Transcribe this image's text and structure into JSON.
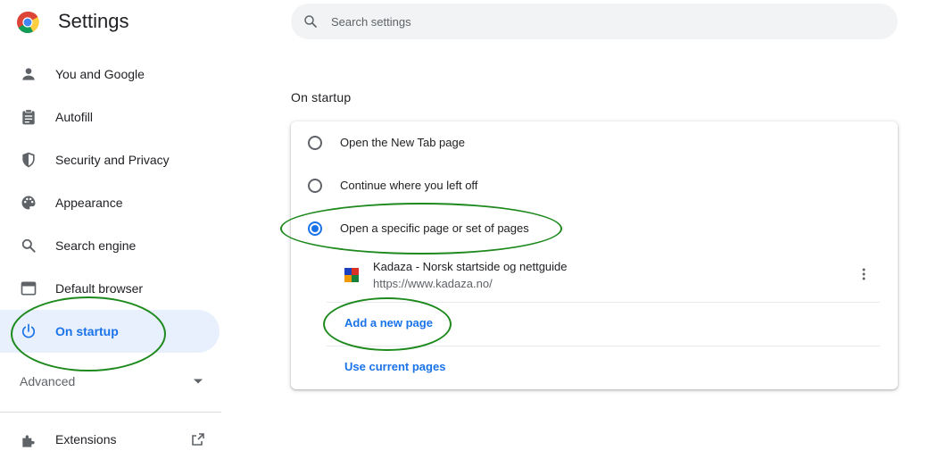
{
  "header": {
    "title": "Settings",
    "search_placeholder": "Search settings"
  },
  "sidebar": {
    "items": [
      {
        "label": "You and Google",
        "icon": "person-icon"
      },
      {
        "label": "Autofill",
        "icon": "clipboard-icon"
      },
      {
        "label": "Security and Privacy",
        "icon": "shield-icon"
      },
      {
        "label": "Appearance",
        "icon": "palette-icon"
      },
      {
        "label": "Search engine",
        "icon": "search-icon"
      },
      {
        "label": "Default browser",
        "icon": "browser-window-icon"
      },
      {
        "label": "On startup",
        "icon": "power-icon",
        "active": true
      }
    ],
    "advanced_label": "Advanced",
    "extensions_label": "Extensions"
  },
  "main": {
    "section_title": "On startup",
    "options": [
      {
        "label": "Open the New Tab page",
        "checked": false
      },
      {
        "label": "Continue where you left off",
        "checked": false
      },
      {
        "label": "Open a specific page or set of pages",
        "checked": true
      }
    ],
    "page_entry": {
      "name": "Kadaza - Norsk startside og nettguide",
      "url": "https://www.kadaza.no/"
    },
    "add_page_label": "Add a new page",
    "use_current_label": "Use current pages"
  },
  "colors": {
    "accent": "#1a73e8",
    "active_bg": "#e8f0fe",
    "annotation": "#1e8a1e"
  }
}
